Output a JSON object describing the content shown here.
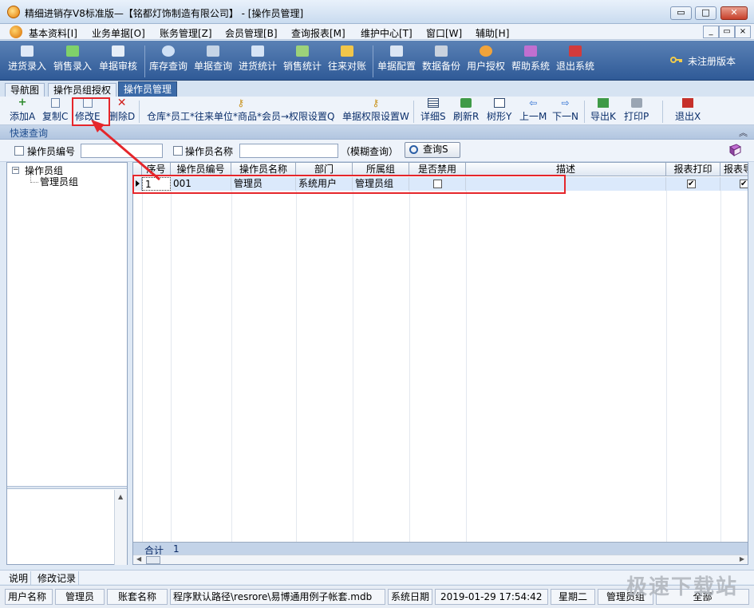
{
  "window": {
    "title": "精细进销存V8标准版—【铭都灯饰制造有限公司】 - [操作员管理]",
    "controls": [
      "▭",
      "□",
      "✕"
    ]
  },
  "menubar": {
    "items": [
      "基本资料[I]",
      "业务单据[O]",
      "账务管理[Z]",
      "会员管理[B]",
      "查询报表[M]",
      "维护中心[T]",
      "窗口[W]",
      "辅助[H]"
    ],
    "mdi_controls": [
      "_",
      "▭",
      "×"
    ]
  },
  "main_toolbar": {
    "buttons": [
      {
        "label": "进货录入",
        "icon": "purchase-entry-icon",
        "color": "#dfe9f7"
      },
      {
        "label": "销售录入",
        "icon": "sales-entry-icon",
        "color": "#7fd16a"
      },
      {
        "label": "单据审核",
        "icon": "audit-icon",
        "color": "#e6eef8"
      },
      {
        "label": "库存查询",
        "icon": "stock-search-icon",
        "color": "#cfe0f5"
      },
      {
        "label": "单据查询",
        "icon": "bill-search-icon",
        "color": "#c5d4e6"
      },
      {
        "label": "进货统计",
        "icon": "purchase-stats-icon",
        "color": "#d6e4f6"
      },
      {
        "label": "销售统计",
        "icon": "sales-stats-icon",
        "color": "#9cd27a"
      },
      {
        "label": "往来对账",
        "icon": "reconcile-icon",
        "color": "#f1c64a"
      },
      {
        "label": "单据配置",
        "icon": "bill-config-icon",
        "color": "#dbe6f4"
      },
      {
        "label": "数据备份",
        "icon": "backup-icon",
        "color": "#c9d2de"
      },
      {
        "label": "用户授权",
        "icon": "user-auth-icon",
        "color": "#f0a33b"
      },
      {
        "label": "帮助系统",
        "icon": "help-book-icon",
        "color": "#c06fd0"
      },
      {
        "label": "退出系统",
        "icon": "exit-door-icon",
        "color": "#d23b3b"
      }
    ],
    "register_text": "未注册版本"
  },
  "tabs": [
    {
      "label": "导航图",
      "active": false
    },
    {
      "label": "操作员组授权",
      "active": false
    },
    {
      "label": "操作员管理",
      "active": true
    }
  ],
  "sub_toolbar": {
    "buttons": [
      {
        "label": "添加A",
        "icon": "add-icon"
      },
      {
        "label": "复制C",
        "icon": "copy-icon"
      },
      {
        "label": "修改E",
        "icon": "edit-icon"
      },
      {
        "label": "删除D",
        "icon": "delete-icon"
      },
      {
        "label": "仓库*员工*往来单位*商品*会员→权限设置Q",
        "icon": "key-icon"
      },
      {
        "label": "单据权限设置W",
        "icon": "key-icon"
      },
      {
        "label": "详细S",
        "icon": "detail-icon"
      },
      {
        "label": "刷新R",
        "icon": "refresh-icon"
      },
      {
        "label": "树形Y",
        "icon": "tree-icon"
      },
      {
        "label": "上一M",
        "icon": "arrow-left-icon"
      },
      {
        "label": "下一N",
        "icon": "arrow-right-icon"
      },
      {
        "label": "导出K",
        "icon": "export-icon"
      },
      {
        "label": "打印P",
        "icon": "print-icon"
      },
      {
        "label": "退出X",
        "icon": "exit-icon"
      }
    ]
  },
  "quick_query": {
    "label": "快速查询",
    "collapse_glyph": "︽"
  },
  "filters": {
    "operator_no_label": "操作员编号",
    "operator_no_value": "",
    "operator_name_label": "操作员名称",
    "operator_name_value": "",
    "fuzzy_hint": "（模糊查询）",
    "query_button": "查询S"
  },
  "tree": {
    "root": "操作员组",
    "expander": "−",
    "children": [
      "管理员组"
    ]
  },
  "grid": {
    "columns": [
      "序号",
      "操作员编号",
      "操作员名称",
      "部门",
      "所属组",
      "是否禁用",
      "描述",
      "报表打印",
      "报表导"
    ],
    "rows": [
      {
        "seq": "1",
        "code": "001",
        "name": "管理员",
        "dept": "系统用户",
        "group": "管理员组",
        "disabled": false,
        "desc": "",
        "report_print": true,
        "report_export": true
      }
    ],
    "footer_label": "合计",
    "footer_count": "1"
  },
  "bottom_tabs": [
    "说明",
    "修改记录"
  ],
  "statusbar": {
    "user_label": "用户名称",
    "user_value": "管理员",
    "account_label": "账套名称",
    "path_text": "程序默认路径\\resrore\\易博通用例子帐套.mdb",
    "date_label": "系统日期",
    "datetime": "2019-01-29  17:54:42",
    "weekday": "星期二",
    "role": "管理员组",
    "scope": "全部"
  },
  "watermark": "极速下载站",
  "colors": {
    "toolbar_blue": "#3b6aa8",
    "highlight_red": "#e5262b",
    "selected_row": "#dbe9fb"
  }
}
